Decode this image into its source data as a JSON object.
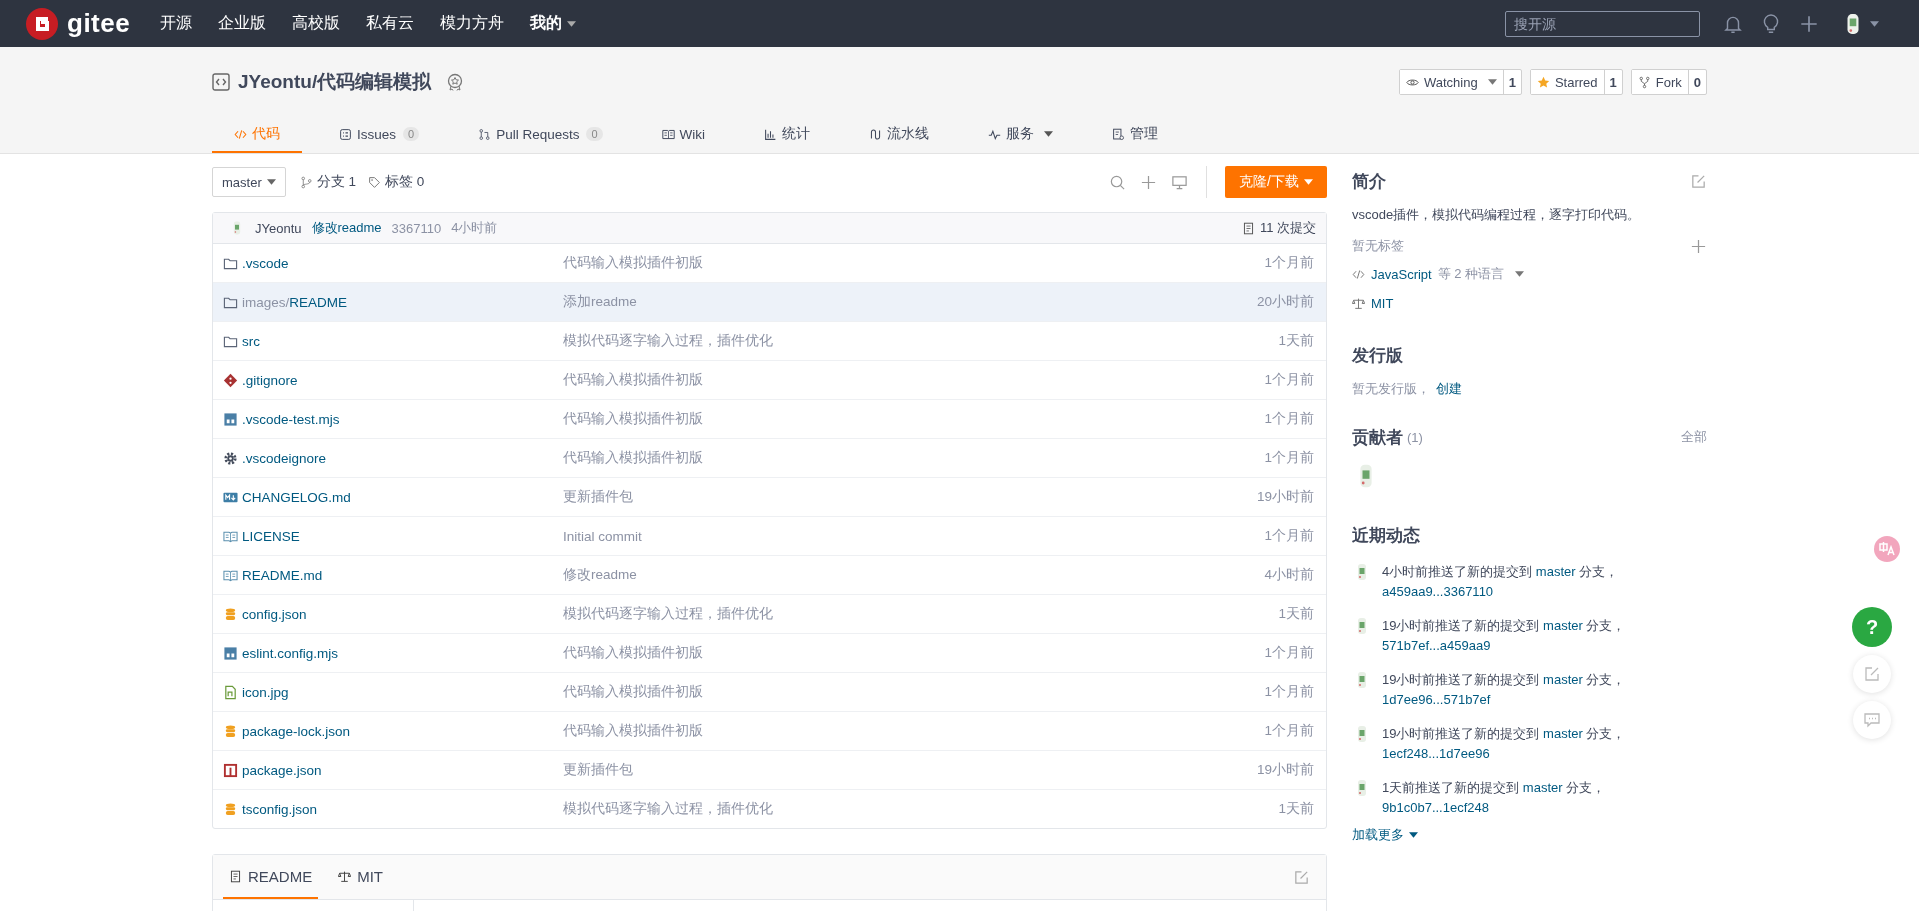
{
  "nav": {
    "logo": "gitee",
    "items": [
      {
        "label": "开源",
        "kind": "plain"
      },
      {
        "label": "企业版",
        "kind": "plain"
      },
      {
        "label": "高校版",
        "kind": "plain"
      },
      {
        "label": "私有云",
        "kind": "plain"
      },
      {
        "label": "模力方舟",
        "kind": "plain"
      },
      {
        "label": "我的",
        "kind": "menu"
      }
    ],
    "search": {
      "placeholder": "搜开源"
    }
  },
  "repo": {
    "title": "JYeontu/代码编辑模拟",
    "actions": [
      {
        "label": "Watching",
        "count": "1",
        "kind": "watch"
      },
      {
        "label": "Starred",
        "count": "1",
        "kind": "star"
      },
      {
        "label": "Fork",
        "count": "0",
        "kind": "fork"
      }
    ],
    "tabs": [
      {
        "label": "代码",
        "kind": "code",
        "selected": true
      },
      {
        "label": "Issues",
        "count": "0",
        "kind": "issues",
        "selected": false
      },
      {
        "label": "Pull Requests",
        "count": "0",
        "kind": "pr",
        "selected": false
      },
      {
        "label": "Wiki",
        "kind": "wiki",
        "selected": false
      },
      {
        "label": "统计",
        "kind": "stats",
        "selected": false
      },
      {
        "label": "流水线",
        "kind": "pipeline",
        "selected": false
      },
      {
        "label": "服务",
        "kind": "service",
        "selected": false
      },
      {
        "label": "管理",
        "kind": "manage",
        "selected": false
      }
    ]
  },
  "toolbar": {
    "branch": "master",
    "branches": "分支 1",
    "tags": "标签 0",
    "clone": "克隆/下载"
  },
  "commit": {
    "author": "JYeontu",
    "message": "修改readme",
    "hash": "3367110",
    "time": "4小时前",
    "count": "11 次提交"
  },
  "files": [
    {
      "name": ".vscode",
      "kind": "folder",
      "message": "代码输入模拟插件初版",
      "time": "1个月前",
      "highlighted": false
    },
    {
      "path": "images/",
      "name": "README",
      "kind": "folder",
      "message": "添加readme",
      "time": "20小时前",
      "highlighted": true
    },
    {
      "name": "src",
      "kind": "folder",
      "message": "模拟代码逐字输入过程，插件优化",
      "time": "1天前",
      "highlighted": false
    },
    {
      "name": ".gitignore",
      "kind": "git",
      "message": "代码输入模拟插件初版",
      "time": "1个月前",
      "highlighted": false
    },
    {
      "name": ".vscode-test.mjs",
      "kind": "js",
      "message": "代码输入模拟插件初版",
      "time": "1个月前",
      "highlighted": false
    },
    {
      "name": ".vscodeignore",
      "kind": "gear",
      "message": "代码输入模拟插件初版",
      "time": "1个月前",
      "highlighted": false
    },
    {
      "name": "CHANGELOG.md",
      "kind": "md",
      "message": "更新插件包",
      "time": "19小时前",
      "highlighted": false
    },
    {
      "name": "LICENSE",
      "kind": "book",
      "message": "Initial commit",
      "time": "1个月前",
      "highlighted": false
    },
    {
      "name": "README.md",
      "kind": "book",
      "message": "修改readme",
      "time": "4小时前",
      "highlighted": false
    },
    {
      "name": "config.json",
      "kind": "db",
      "message": "模拟代码逐字输入过程，插件优化",
      "time": "1天前",
      "highlighted": false
    },
    {
      "name": "eslint.config.mjs",
      "kind": "js",
      "message": "代码输入模拟插件初版",
      "time": "1个月前",
      "highlighted": false
    },
    {
      "name": "icon.jpg",
      "kind": "image",
      "message": "代码输入模拟插件初版",
      "time": "1个月前",
      "highlighted": false
    },
    {
      "name": "package-lock.json",
      "kind": "db",
      "message": "代码输入模拟插件初版",
      "time": "1个月前",
      "highlighted": false
    },
    {
      "name": "package.json",
      "kind": "npm",
      "message": "更新插件包",
      "time": "19小时前",
      "highlighted": false
    },
    {
      "name": "tsconfig.json",
      "kind": "db",
      "message": "模拟代码逐字输入过程，插件优化",
      "time": "1天前",
      "highlighted": false
    }
  ],
  "readme_tabs": [
    {
      "label": "README",
      "kind": "doc",
      "selected": true
    },
    {
      "label": "MIT",
      "kind": "scale",
      "selected": false
    }
  ],
  "sidebar": {
    "intro_title": "简介",
    "description": "vscode插件，模拟代码编程过程，逐字打印代码。",
    "no_tags": "暂无标签",
    "language": "JavaScript",
    "language_more": "等 2 种语言",
    "license": "MIT",
    "releases_title": "发行版",
    "no_releases": "暂无发行版，",
    "create": "创建",
    "contributors_title": "贡献者",
    "contributors_count": "(1)",
    "all": "全部",
    "activity_title": "近期动态",
    "activities": [
      {
        "text": "4小时前推送了新的提交到",
        "branch": "master",
        "mid": "分支，",
        "commits": "a459aa9...3367110"
      },
      {
        "text": "19小时前推送了新的提交到",
        "branch": "master",
        "mid": "分支，",
        "commits": "571b7ef...a459aa9"
      },
      {
        "text": "19小时前推送了新的提交到",
        "branch": "master",
        "mid": "分支，",
        "commits": "1d7ee96...571b7ef"
      },
      {
        "text": "19小时前推送了新的提交到",
        "branch": "master",
        "mid": "分支，",
        "commits": "1ecf248...1d7ee96"
      },
      {
        "text": "1天前推送了新的提交到",
        "branch": "master",
        "mid": "分支，",
        "commits": "9b1c0b7...1ecf248"
      }
    ],
    "load_more": "加载更多"
  },
  "help": "?"
}
